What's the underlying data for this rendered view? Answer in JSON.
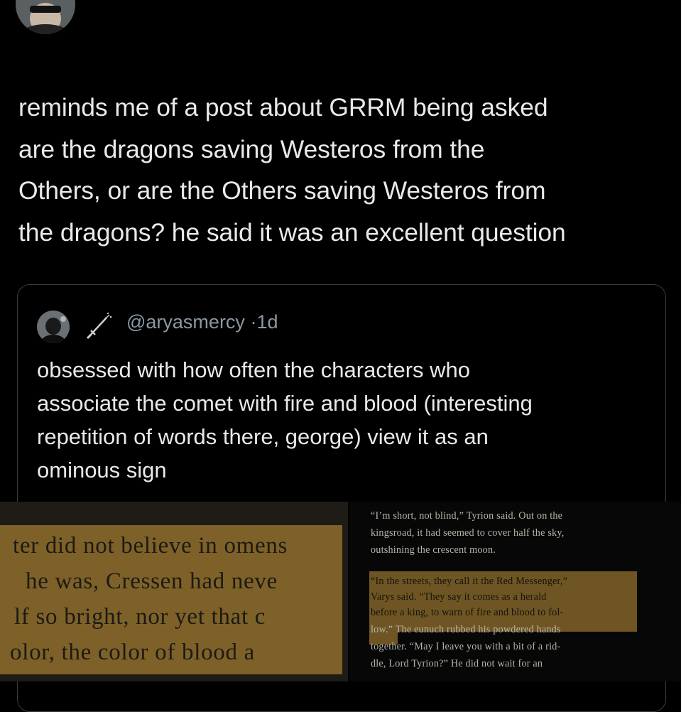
{
  "tweet": {
    "lines": [
      "reminds me of a post about GRRM being asked",
      "are the dragons saving Westeros from the",
      "Others, or are the Others saving Westeros from",
      "the dragons? he said it was an excellent question"
    ]
  },
  "quote": {
    "handle": "@aryasmercy",
    "separator": "·",
    "time": "1d",
    "lines": [
      "obsessed with how often the characters who",
      "associate the comet with fire and blood (interesting",
      "repetition of words there, george) view it as an",
      "ominous sign"
    ]
  },
  "book_left": {
    "lines": [
      "ter did not believe in omens",
      "he was, Cressen had neve",
      "lf so bright, nor yet that c",
      "olor, the color of blood a"
    ]
  },
  "book_right": {
    "para1": [
      "“I’m short, not blind,” Tyrion said. Out on the",
      "kingsroad, it had seemed to cover half the sky,",
      "outshining the crescent moon."
    ],
    "para2": [
      "“In the streets, they call it the Red Messenger,”",
      "Varys said. “They say it comes as a herald",
      "before a king, to warn of fire and blood to fol-",
      "low.” The eunuch rubbed his powdered hands",
      "together. “May I leave you with a bit of a rid-",
      "dle, Lord Tyrion?” He did not wait for an"
    ]
  },
  "colors": {
    "background": "#000000",
    "text": "#e7e9ea",
    "muted": "#8b98a5",
    "highlight": "#7d6128"
  }
}
